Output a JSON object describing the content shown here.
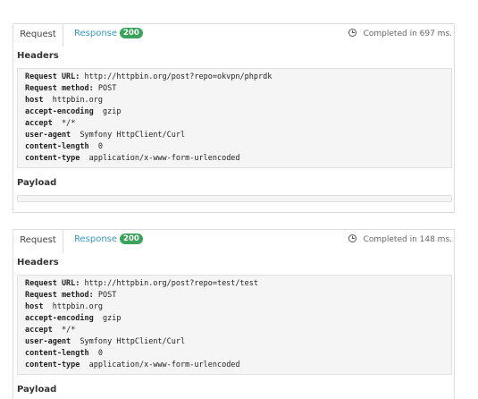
{
  "requests": [
    {
      "tab_request": "Request",
      "tab_response": "Response",
      "status": "200",
      "completed": "Completed in 697 ms.",
      "headers_title": "Headers",
      "headers": [
        {
          "key": "Request URL:",
          "value": "http://httpbin.org/post?repo=okvpn/phprdk"
        },
        {
          "key": "Request method:",
          "value": "POST"
        },
        {
          "key": "host",
          "value": "httpbin.org"
        },
        {
          "key": "accept-encoding",
          "value": "gzip"
        },
        {
          "key": "accept",
          "value": "*/*"
        },
        {
          "key": "user-agent",
          "value": "Symfony HttpClient/Curl"
        },
        {
          "key": "content-length",
          "value": "0"
        },
        {
          "key": "content-type",
          "value": "application/x-www-form-urlencoded"
        }
      ],
      "payload_title": "Payload"
    },
    {
      "tab_request": "Request",
      "tab_response": "Response",
      "status": "200",
      "completed": "Completed in 148 ms.",
      "headers_title": "Headers",
      "headers": [
        {
          "key": "Request URL:",
          "value": "http://httpbin.org/post?repo=test/test"
        },
        {
          "key": "Request method:",
          "value": "POST"
        },
        {
          "key": "host",
          "value": "httpbin.org"
        },
        {
          "key": "accept-encoding",
          "value": "gzip"
        },
        {
          "key": "accept",
          "value": "*/*"
        },
        {
          "key": "user-agent",
          "value": "Symfony HttpClient/Curl"
        },
        {
          "key": "content-length",
          "value": "0"
        },
        {
          "key": "content-type",
          "value": "application/x-www-form-urlencoded"
        }
      ],
      "payload_title": "Payload"
    }
  ],
  "colors": {
    "accent": "#3a99c7",
    "badge": "#3ba35a",
    "box_bg": "#f5f5f5"
  },
  "icons": {
    "completed": "clock-icon"
  }
}
